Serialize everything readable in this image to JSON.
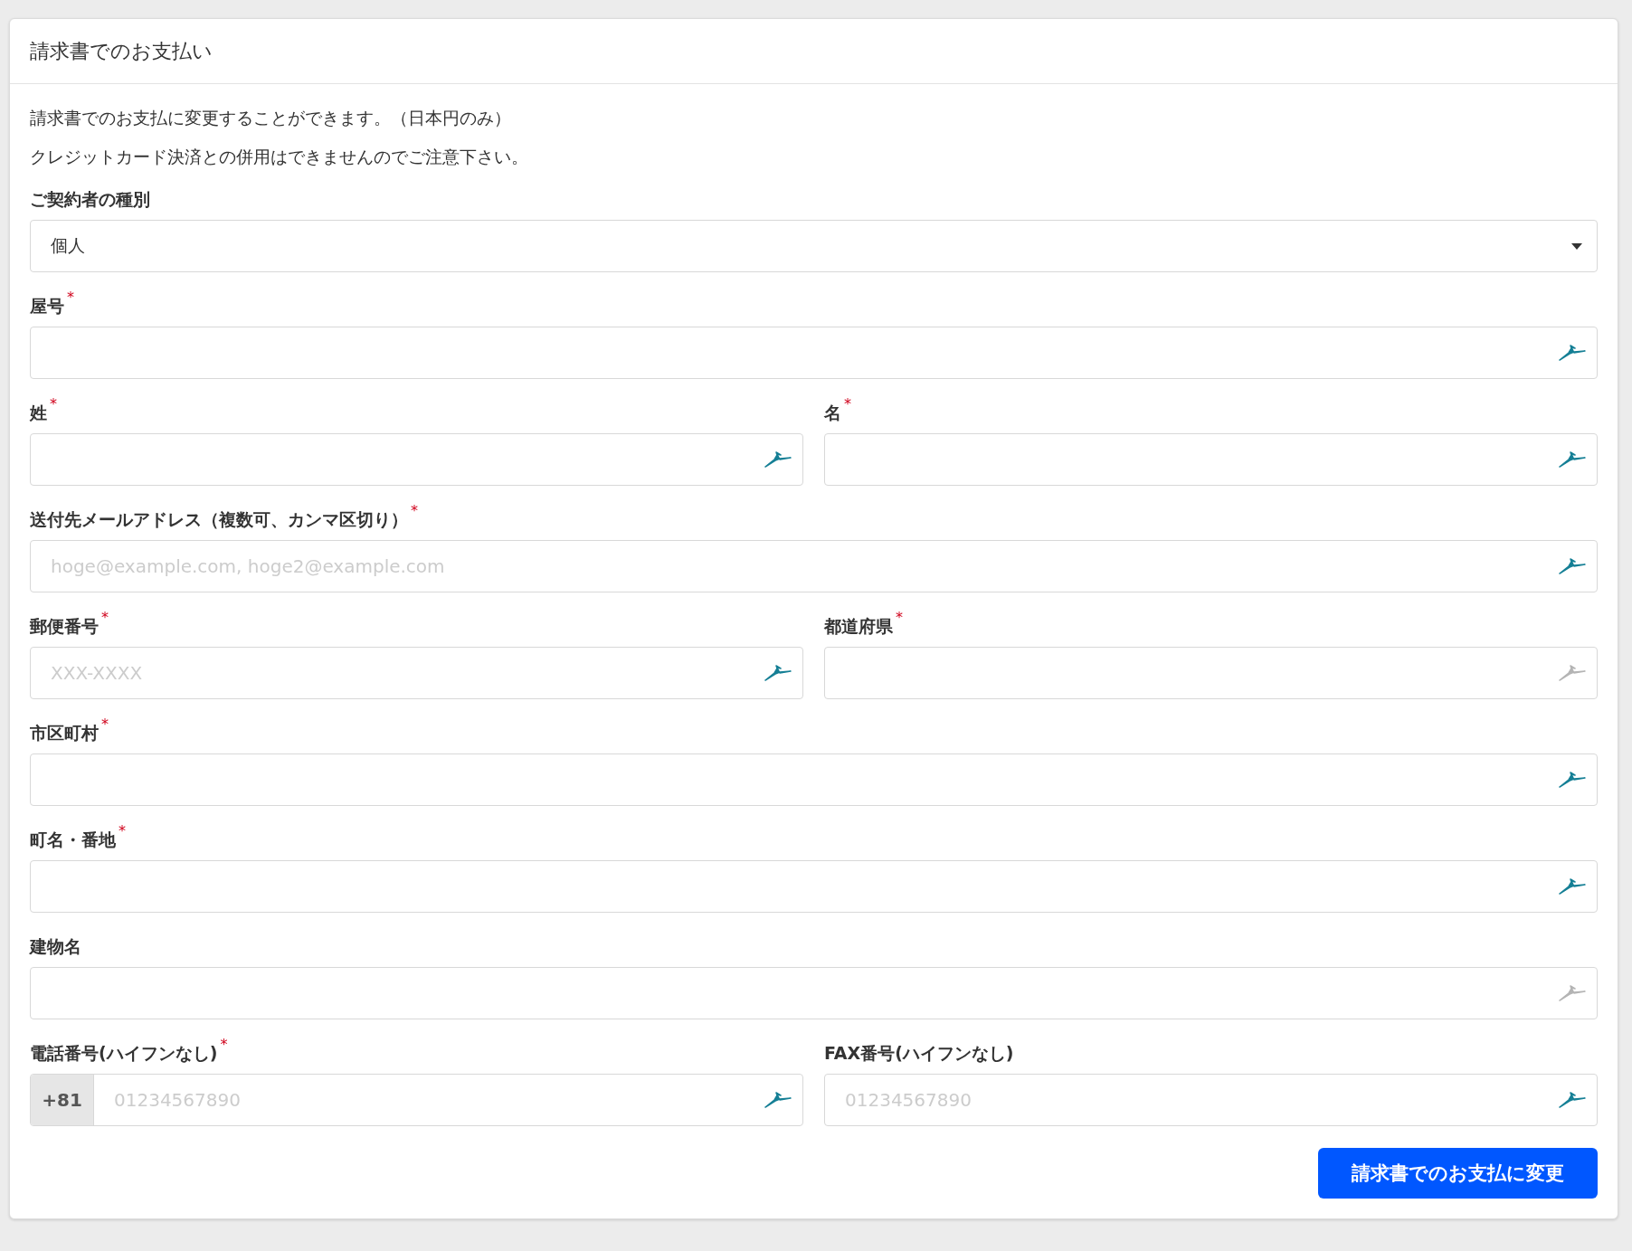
{
  "card": {
    "title": "請求書でのお支払い"
  },
  "notes": [
    "請求書でのお支払に変更することができます。（日本円のみ）",
    "クレジットカード決済との併用はできませんのでご注意下さい。"
  ],
  "rows": [
    [
      {
        "kind": "select",
        "label": "ご契約者の種別",
        "value": "個人"
      }
    ],
    [
      {
        "kind": "text",
        "label": "屋号",
        "required_mark": "*",
        "autofill_active": true
      }
    ],
    [
      {
        "kind": "text",
        "label": "姓",
        "required_mark": "*",
        "autofill_active": true
      },
      {
        "kind": "text",
        "label": "名",
        "required_mark": "*",
        "autofill_active": true
      }
    ],
    [
      {
        "kind": "text",
        "label": "送付先メールアドレス（複数可、カンマ区切り）",
        "required_mark": "*",
        "placeholder": "hoge@example.com, hoge2@example.com",
        "autofill_active": true
      }
    ],
    [
      {
        "kind": "text",
        "label": "郵便番号",
        "required_mark": "*",
        "placeholder": "XXX-XXXX",
        "autofill_active": true
      },
      {
        "kind": "text",
        "label": "都道府県",
        "required_mark": "*",
        "autofill_active": false
      }
    ],
    [
      {
        "kind": "text",
        "label": "市区町村",
        "required_mark": "*",
        "autofill_active": true
      }
    ],
    [
      {
        "kind": "text",
        "label": "町名・番地",
        "required_mark": "*",
        "autofill_active": true
      }
    ],
    [
      {
        "kind": "text",
        "label": "建物名",
        "autofill_active": false
      }
    ],
    [
      {
        "kind": "tel",
        "label": "電話番号(ハイフンなし)",
        "required_mark": "*",
        "prefix": "+81",
        "placeholder": "01234567890",
        "autofill_active": true
      },
      {
        "kind": "text",
        "label": "FAX番号(ハイフンなし)",
        "placeholder": "01234567890",
        "autofill_active": true
      }
    ]
  ],
  "submit": {
    "label": "請求書でのお支払に変更"
  }
}
